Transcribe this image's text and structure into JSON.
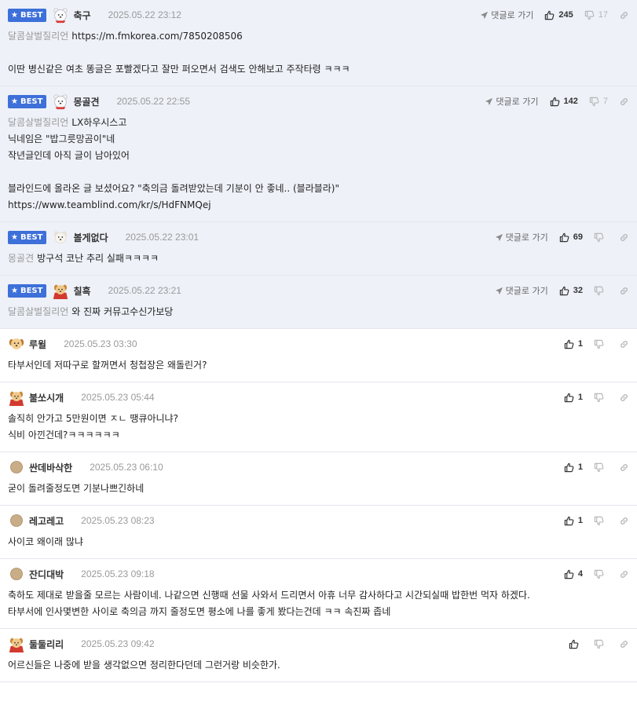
{
  "best_label": "BEST",
  "reply_label": "댓글로 가기",
  "comments": [
    {
      "best": true,
      "avatar": "bear",
      "nickname": "축구",
      "date": "2025.05.22 23:12",
      "upvotes": "245",
      "downvotes": "17",
      "lines": [
        {
          "mention": "달콤살벌질리언",
          "text": "https://m.fmkorea.com/7850208506"
        },
        {
          "blank": true
        },
        {
          "text": "이딴 병신같은 여초 똥글은 포빨겠다고 잘만 퍼오면서 검색도 안해보고 주작타령 ㅋㅋㅋ"
        }
      ]
    },
    {
      "best": true,
      "avatar": "bear",
      "nickname": "몽골견",
      "date": "2025.05.22 22:55",
      "upvotes": "142",
      "downvotes": "7",
      "lines": [
        {
          "mention": "달콤살벌질리언",
          "text": "LX하우시스고"
        },
        {
          "text": "닉네임은 \"밥그릇망곰이\"네"
        },
        {
          "text": "작년글인데 아직 글이 남아있어"
        },
        {
          "blank": true
        },
        {
          "text": "블라인드에 올라온 글 보셨어요? \"축의금 돌려받았는데 기분이 안 좋네.. (블라블라)\""
        },
        {
          "text": "https://www.teamblind.com/kr/s/HdFNMQej"
        }
      ]
    },
    {
      "best": true,
      "avatar": "dog-white",
      "nickname": "볼게없다",
      "date": "2025.05.22 23:01",
      "upvotes": "69",
      "downvotes": "",
      "lines": [
        {
          "mention": "몽골견",
          "text": "방구석 코난 추리 실패ㅋㅋㅋㅋ"
        }
      ]
    },
    {
      "best": true,
      "avatar": "dog-cape",
      "nickname": "칠흑",
      "date": "2025.05.22 23:21",
      "upvotes": "32",
      "downvotes": "",
      "lines": [
        {
          "mention": "달콤살벌질리언",
          "text": "와 진짜 커뮤고수신가보당"
        }
      ]
    },
    {
      "best": false,
      "avatar": "dog-face",
      "nickname": "루윌",
      "date": "2025.05.23 03:30",
      "upvotes": "1",
      "downvotes": "",
      "lines": [
        {
          "text": "타부서인데 저따구로 할꺼면서 청첩장은 왜돌린거?"
        }
      ]
    },
    {
      "best": false,
      "avatar": "dog-cape",
      "nickname": "불쏘시개",
      "date": "2025.05.23 05:44",
      "upvotes": "1",
      "downvotes": "",
      "lines": [
        {
          "text": "솔직히 안가고 5만원이면 ㅈㄴ 땡큐아니냐?"
        },
        {
          "text": "식비 아낀건데?ㅋㅋㅋㅋㅋㅋ"
        }
      ]
    },
    {
      "best": false,
      "avatar": "dot",
      "nickname": "싼데바삭한",
      "date": "2025.05.23 06:10",
      "upvotes": "1",
      "downvotes": "",
      "lines": [
        {
          "text": "굳이 돌려줄정도면 기분나쁘긴하네"
        }
      ]
    },
    {
      "best": false,
      "avatar": "dot",
      "nickname": "레고레고",
      "date": "2025.05.23 08:23",
      "upvotes": "1",
      "downvotes": "",
      "lines": [
        {
          "text": "사이코 왜이래 많냐"
        }
      ]
    },
    {
      "best": false,
      "avatar": "dot",
      "nickname": "잔디대박",
      "date": "2025.05.23 09:18",
      "upvotes": "4",
      "downvotes": "",
      "lines": [
        {
          "text": "축하도 제대로 받을줄 모르는 사람이네. 나같으면 신행때 선물 사와서 드리면서 아휴 너무 감사하다고 시간되실때 밥한번 먹자 하겠다."
        },
        {
          "text": "타부서에 인사몇변한 사이로 축의금 까지 줄정도면 평소에 나를 좋게 봤다는건데 ㅋㅋ 속진짜 좁네"
        }
      ]
    },
    {
      "best": false,
      "avatar": "dog-cape",
      "nickname": "둘둘리리",
      "date": "2025.05.23 09:42",
      "upvotes": "",
      "downvotes": "",
      "lines": [
        {
          "text": "어르신들은 나중에 받을 생각없으면 정리한다던데 그런거랑 비슷한가."
        }
      ]
    }
  ]
}
